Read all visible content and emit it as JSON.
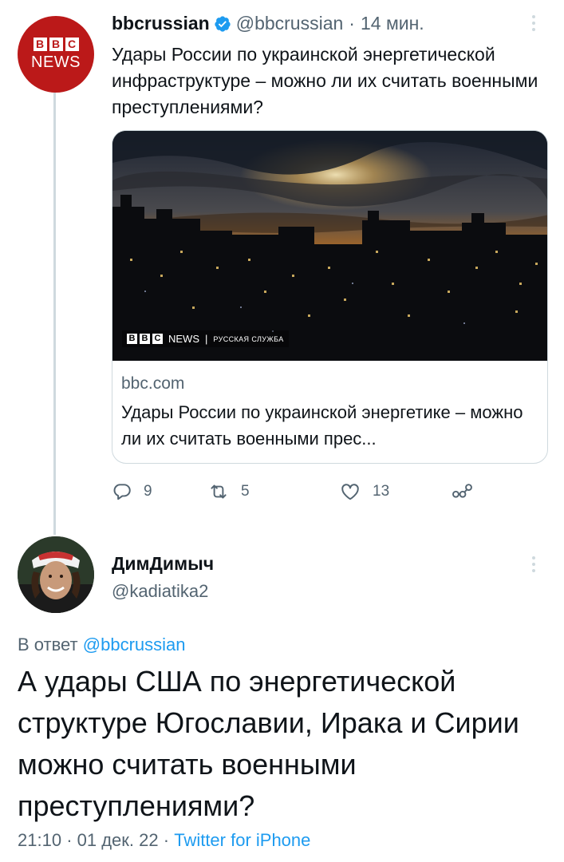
{
  "tweet": {
    "author_name": "bbcrussian",
    "author_handle": "@bbcrussian",
    "separator": "·",
    "time_ago": "14 мин.",
    "avatar": {
      "logo_letters": [
        "B",
        "B",
        "C"
      ],
      "logo_word": "NEWS"
    },
    "text": "Удары России по украинской энергетической инфраструктуре – можно ли их считать военными преступлениями?",
    "card": {
      "image_caption": {
        "logo_letters": [
          "B",
          "B",
          "C"
        ],
        "news": "NEWS",
        "separator": "|",
        "service": "РУССКАЯ СЛУЖБА"
      },
      "domain": "bbc.com",
      "title": "Удары России по украинской энергетике – можно ли их считать военными прес..."
    },
    "actions": {
      "replies": "9",
      "retweets": "5",
      "likes": "13"
    }
  },
  "reply": {
    "author_name": "ДимДимыч",
    "author_handle": "@kadiatika2",
    "reply_prefix": "В ответ",
    "reply_mention": "@bbcrussian",
    "text": "А удары США по энергетической структуре Югославии, Ирака и Сирии можно считать военными преступлениями?",
    "time": "21:10",
    "separator": "·",
    "date": "01 дек. 22",
    "separator2": "·",
    "source": "Twitter for iPhone"
  },
  "colors": {
    "accent": "#1d9bf0",
    "secondary_text": "#536471",
    "bbc_red": "#bb1919",
    "border": "#cfd9de"
  },
  "icons": [
    "verified-badge-icon",
    "more-options-icon",
    "reply-icon",
    "retweet-icon",
    "like-icon",
    "share-icon"
  ]
}
